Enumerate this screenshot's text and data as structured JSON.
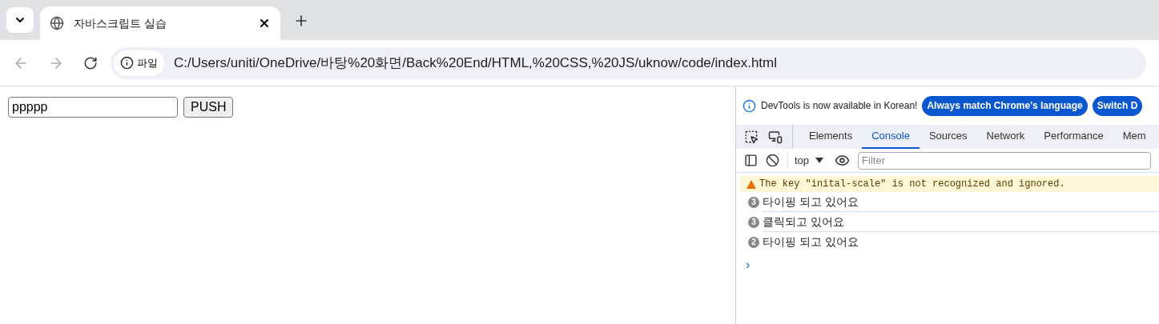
{
  "browser_tab": {
    "title": "자바스크립트 실습"
  },
  "address_bar": {
    "badge": "파일",
    "url": "C:/Users/uniti/OneDrive/바탕%20화면/Back%20End/HTML,%20CSS,%20JS/uknow/code/index.html"
  },
  "page": {
    "input_value": "ppppp",
    "button": "PUSH"
  },
  "devtools": {
    "notice": "DevTools is now available in Korean!",
    "notice_buttons": [
      "Always match Chrome's language",
      "Switch D"
    ],
    "tabs": [
      {
        "label": "Elements",
        "selected": false
      },
      {
        "label": "Console",
        "selected": true
      },
      {
        "label": "Sources",
        "selected": false
      },
      {
        "label": "Network",
        "selected": false
      },
      {
        "label": "Performance",
        "selected": false
      },
      {
        "label": "Mem",
        "selected": false
      }
    ],
    "context": "top",
    "filter_placeholder": "Filter",
    "messages": [
      {
        "kind": "warning",
        "text": "The key \"inital-scale\" is not recognized and ignored."
      },
      {
        "kind": "log",
        "count": "3",
        "text": "타이핑 되고 있어요"
      },
      {
        "kind": "log",
        "count": "3",
        "text": "클릭되고 있어요"
      },
      {
        "kind": "log",
        "count": "2",
        "text": "타이핑 되고 있어요"
      }
    ],
    "prompt": "›"
  }
}
